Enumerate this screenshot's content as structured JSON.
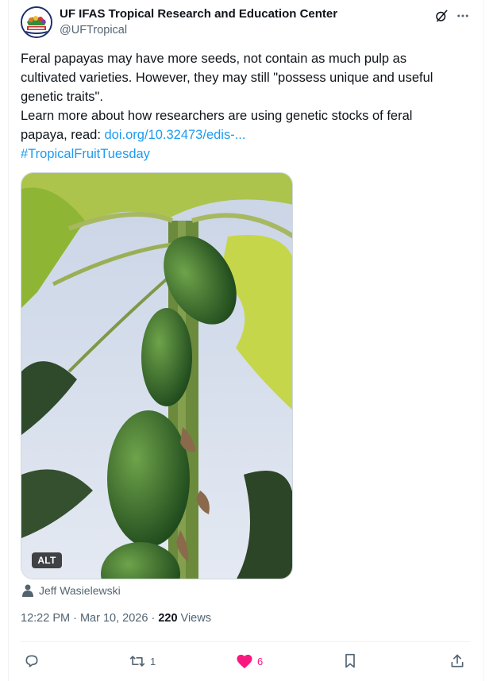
{
  "tweet": {
    "author_name": "UF IFAS Tropical Research and Education Center",
    "author_handle": "@UFTropical",
    "text_lines": [
      "Feral papayas may have more seeds, not contain as much pulp as",
      "cultivated varieties. However, they may still \"possess unique and useful",
      "genetic traits\".",
      "Learn more about how researchers are using genetic stocks of feral",
      "papaya, read: "
    ],
    "link_text": "doi.org/10.32473/edis-...",
    "hashtag": "#TropicalFruitTuesday",
    "media_alt_badge": "ALT",
    "photo_credit": "Jeff Wasielewski",
    "time": "12:22 PM",
    "date": "Mar 10, 2026",
    "meta_sep": " · ",
    "views_count": "220",
    "views_label": " Views"
  },
  "actions": {
    "reply_count": "",
    "retweet_count": "1",
    "like_count": "6",
    "bookmark_count": ""
  },
  "icons": [
    "avatar-logo",
    "grok-icon",
    "more-icon",
    "person-icon",
    "reply-icon",
    "retweet-icon",
    "heart-icon",
    "bookmark-icon",
    "share-icon"
  ],
  "colors": {
    "link": "#1d9bf0",
    "like": "#f91880",
    "secondary_text": "#536471",
    "primary_text": "#0f1419"
  }
}
